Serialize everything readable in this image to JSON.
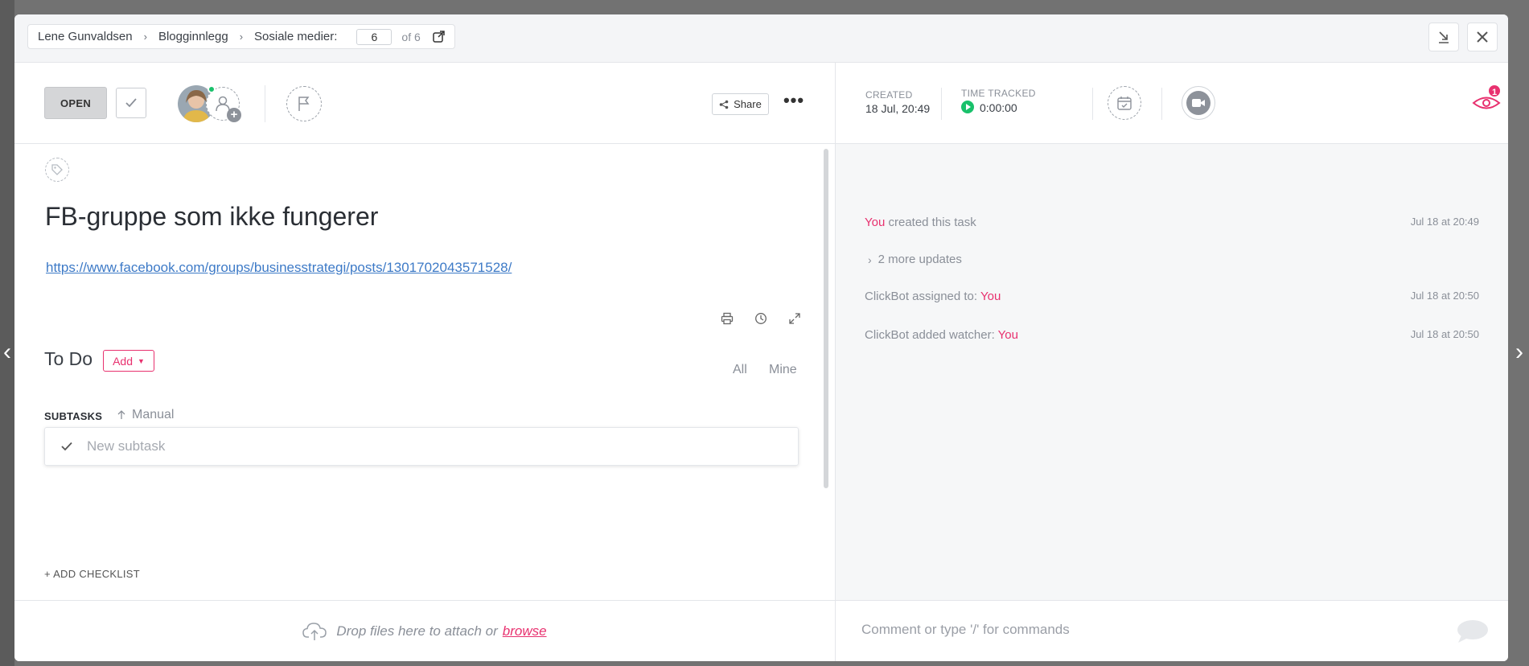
{
  "breadcrumb": {
    "items": [
      "Lene Gunvaldsen",
      "Blogginnlegg",
      "Sosiale medier:"
    ],
    "page_value": "6",
    "page_total": "of 6"
  },
  "header": {
    "status_label": "OPEN",
    "share_label": "Share",
    "more_label": "•••"
  },
  "task": {
    "title": "FB-gruppe som ikke fungerer",
    "link": "https://www.facebook.com/groups/businesstrategi/posts/1301702043571528/"
  },
  "todo": {
    "title": "To Do",
    "add_label": "Add",
    "filter_all": "All",
    "filter_mine": "Mine",
    "subtasks_label": "SUBTASKS",
    "sort_label": "Manual",
    "new_subtask_placeholder": "New subtask",
    "add_checklist_label": "+ ADD CHECKLIST"
  },
  "attachments": {
    "drop_text": "Drop files here to attach or",
    "browse_label": "browse"
  },
  "meta": {
    "created_label": "CREATED",
    "created_value": "18 Jul, 20:49",
    "time_tracked_label": "TIME TRACKED",
    "time_tracked_value": "0:00:00",
    "watchers_count": "1"
  },
  "activity": {
    "items": [
      {
        "actor": "You",
        "text": " created this task",
        "target": "",
        "time": "Jul 18 at 20:49"
      },
      {
        "actor": "",
        "text": "ClickBot assigned to: ",
        "target": "You",
        "time": "Jul 18 at 20:50"
      },
      {
        "actor": "",
        "text": "ClickBot added watcher: ",
        "target": "You",
        "time": "Jul 18 at 20:50"
      }
    ],
    "more_updates": "2 more updates"
  },
  "comment": {
    "placeholder": "Comment or type '/' for commands"
  },
  "colors": {
    "accent": "#e8316f",
    "link": "#3d7ac7",
    "online": "#19c16b"
  }
}
